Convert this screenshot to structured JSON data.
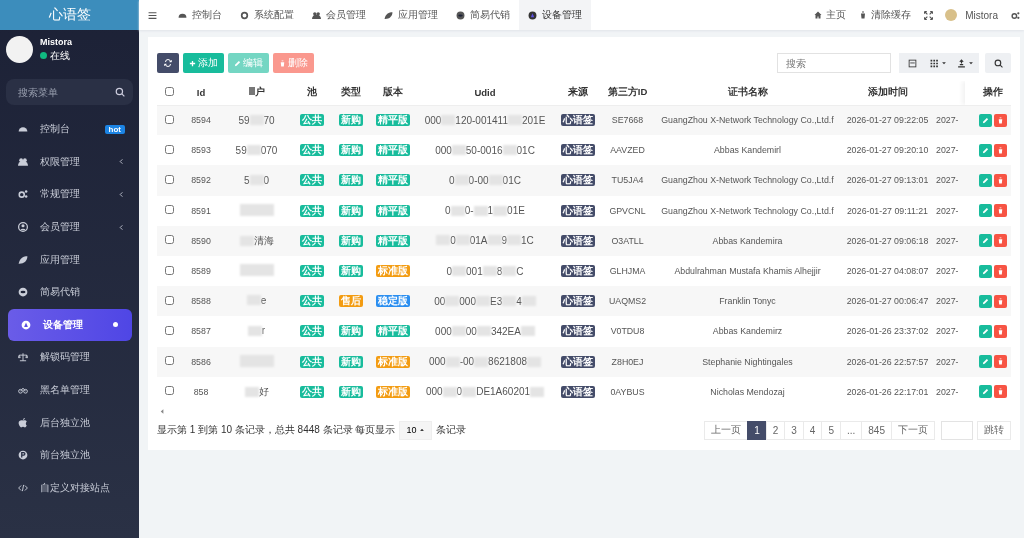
{
  "sidebar": {
    "logo": "心语签",
    "user": {
      "name": "Mistora",
      "status": "在线"
    },
    "search": {
      "placeholder": "搜索菜单"
    },
    "items": [
      {
        "label": "控制台",
        "badge": "hot",
        "expandable": false,
        "selected": false
      },
      {
        "label": "权限管理",
        "expandable": true,
        "selected": false
      },
      {
        "label": "常规管理",
        "expandable": true,
        "selected": false
      },
      {
        "label": "会员管理",
        "expandable": true,
        "selected": false
      },
      {
        "label": "应用管理",
        "expandable": false,
        "selected": false
      },
      {
        "label": "简易代销",
        "expandable": false,
        "selected": false
      },
      {
        "label": "设备管理",
        "expandable": false,
        "selected": true
      },
      {
        "label": "解锁码管理",
        "expandable": false,
        "selected": false
      },
      {
        "label": "黑名单管理",
        "expandable": false,
        "selected": false
      },
      {
        "label": "后台独立池",
        "expandable": false,
        "selected": false
      },
      {
        "label": "前台独立池",
        "expandable": false,
        "selected": false
      },
      {
        "label": "自定义对接站点",
        "expandable": false,
        "selected": false
      }
    ]
  },
  "topbar": {
    "tabs": [
      {
        "label": "控制台",
        "selected": false
      },
      {
        "label": "系统配置",
        "selected": false
      },
      {
        "label": "会员管理",
        "selected": false
      },
      {
        "label": "应用管理",
        "selected": false
      },
      {
        "label": "简易代销",
        "selected": false
      },
      {
        "label": "设备管理",
        "selected": true
      }
    ],
    "right": {
      "home": "主页",
      "clear_cache": "清除缓存",
      "user": "Mistora"
    }
  },
  "toolbar": {
    "buttons": [
      {
        "label": "添加",
        "kind": "add"
      },
      {
        "label": "编辑",
        "kind": "edit"
      },
      {
        "label": "删除",
        "kind": "delete"
      }
    ],
    "search": {
      "placeholder": "搜索"
    }
  },
  "table": {
    "header_checked": false,
    "columns": [
      "Id",
      "户",
      "池",
      "类型",
      "版本",
      "Udid",
      "来源",
      "第三方ID",
      "证书名称",
      "添加时间",
      "",
      "操作"
    ],
    "rows": [
      {
        "checked": false,
        "id": "8594",
        "user": [
          "59",
          {
            "kind": "redacted"
          },
          "70"
        ],
        "pool": "公共",
        "type": {
          "label": "新购",
          "kind": "new"
        },
        "version": {
          "label": "精平版",
          "kind": "green"
        },
        "udid": [
          "000",
          {
            "kind": "redacted"
          },
          "120-001411",
          {
            "kind": "redacted"
          },
          "201E"
        ],
        "source": "心语签",
        "third_party_id": "SE7668",
        "cert_name": "GuangZhou X-Network Technology Co.,Ltd.f",
        "added_time": "2026-01-27 09:22:05",
        "column_11": "2027-"
      },
      {
        "checked": false,
        "id": "8593",
        "user": [
          "59",
          {
            "kind": "redacted"
          },
          "070"
        ],
        "pool": "公共",
        "type": {
          "label": "新购",
          "kind": "new"
        },
        "version": {
          "label": "精平版",
          "kind": "green"
        },
        "udid": [
          "000",
          {
            "kind": "redacted"
          },
          "50-0016",
          {
            "kind": "redacted"
          },
          "01C"
        ],
        "source": "心语签",
        "third_party_id": "AAVZED",
        "cert_name": "Abbas Kandemirl",
        "added_time": "2026-01-27 09:20:10",
        "column_11": "2027-"
      },
      {
        "checked": false,
        "id": "8592",
        "user": [
          "5",
          {
            "kind": "redacted"
          },
          "0"
        ],
        "pool": "公共",
        "type": {
          "label": "新购",
          "kind": "new"
        },
        "version": {
          "label": "精平版",
          "kind": "green"
        },
        "udid": [
          "0",
          {
            "kind": "redacted"
          },
          "0-00",
          {
            "kind": "redacted"
          },
          "01C"
        ],
        "source": "心语签",
        "third_party_id": "TU5JA4",
        "cert_name": "GuangZhou X-Network Technology Co.,Ltd.f",
        "added_time": "2026-01-27 09:13:01",
        "column_11": "2027-"
      },
      {
        "checked": false,
        "id": "8591",
        "user": [
          {
            "kind": "redacted"
          }
        ],
        "pool": "公共",
        "type": {
          "label": "新购",
          "kind": "new"
        },
        "version": {
          "label": "精平版",
          "kind": "green"
        },
        "udid": [
          "0",
          {
            "kind": "redacted"
          },
          "0-",
          {
            "kind": "redacted"
          },
          "1",
          {
            "kind": "redacted"
          },
          "01E"
        ],
        "source": "心语签",
        "third_party_id": "GPVCNL",
        "cert_name": "GuangZhou X-Network Technology Co.,Ltd.f",
        "added_time": "2026-01-27 09:11:21",
        "column_11": "2027-"
      },
      {
        "checked": false,
        "id": "8590",
        "user": [
          {
            "kind": "redacted"
          },
          "清海"
        ],
        "pool": "公共",
        "type": {
          "label": "新购",
          "kind": "new"
        },
        "version": {
          "label": "精平版",
          "kind": "green"
        },
        "udid": [
          {
            "kind": "redacted"
          },
          "0",
          {
            "kind": "redacted"
          },
          "01A",
          {
            "kind": "redacted"
          },
          "9",
          {
            "kind": "redacted"
          },
          "1C"
        ],
        "source": "心语签",
        "third_party_id": "O3ATLL",
        "cert_name": "Abbas Kandemira",
        "added_time": "2026-01-27 09:06:18",
        "column_11": "2027-"
      },
      {
        "checked": false,
        "id": "8589",
        "user": [
          {
            "kind": "redacted"
          }
        ],
        "pool": "公共",
        "type": {
          "label": "新购",
          "kind": "new"
        },
        "version": {
          "label": "标准版",
          "kind": "orange"
        },
        "udid": [
          "0",
          {
            "kind": "redacted"
          },
          "001",
          {
            "kind": "redacted"
          },
          "8",
          {
            "kind": "redacted"
          },
          "C"
        ],
        "source": "心语签",
        "third_party_id": "GLHJMA",
        "cert_name": "Abdulrahman Mustafa Khamis Alhejjir",
        "added_time": "2026-01-27 04:08:07",
        "column_11": "2027-"
      },
      {
        "checked": false,
        "id": "8588",
        "user": [
          {
            "kind": "redacted"
          },
          "e"
        ],
        "pool": "公共",
        "type": {
          "label": "售后",
          "kind": "after_sale"
        },
        "version": {
          "label": "稳定版",
          "kind": "blue"
        },
        "udid": [
          "00",
          {
            "kind": "redacted"
          },
          "000",
          {
            "kind": "redacted"
          },
          "E3",
          {
            "kind": "redacted"
          },
          "4",
          {
            "kind": "redacted"
          }
        ],
        "source": "心语签",
        "third_party_id": "UAQMS2",
        "cert_name": "Franklin Tonyc",
        "added_time": "2026-01-27 00:06:47",
        "column_11": "2027-"
      },
      {
        "checked": false,
        "id": "8587",
        "user": [
          {
            "kind": "redacted"
          },
          "r"
        ],
        "pool": "公共",
        "type": {
          "label": "新购",
          "kind": "new"
        },
        "version": {
          "label": "精平版",
          "kind": "green"
        },
        "udid": [
          "000",
          {
            "kind": "redacted"
          },
          "00",
          {
            "kind": "redacted"
          },
          "342EA",
          {
            "kind": "redacted"
          }
        ],
        "source": "心语签",
        "third_party_id": "V0TDU8",
        "cert_name": "Abbas Kandemirz",
        "added_time": "2026-01-26 23:37:02",
        "column_11": "2027-"
      },
      {
        "checked": false,
        "id": "8586",
        "user": [
          {
            "kind": "redacted"
          }
        ],
        "pool": "公共",
        "type": {
          "label": "新购",
          "kind": "new"
        },
        "version": {
          "label": "标准版",
          "kind": "orange"
        },
        "udid": [
          "000",
          {
            "kind": "redacted"
          },
          "-00",
          {
            "kind": "redacted"
          },
          "8621808",
          {
            "kind": "redacted"
          }
        ],
        "source": "心语签",
        "third_party_id": "Z8H0EJ",
        "cert_name": "Stephanie Nightingales",
        "added_time": "2026-01-26 22:57:57",
        "column_11": "2027-"
      },
      {
        "checked": false,
        "id": "858",
        "user": [
          {
            "kind": "redacted"
          },
          "好"
        ],
        "pool": "公共",
        "type": {
          "label": "新购",
          "kind": "new"
        },
        "version": {
          "label": "标准版",
          "kind": "orange"
        },
        "udid": [
          "000",
          {
            "kind": "redacted"
          },
          "0",
          {
            "kind": "redacted"
          },
          "DE1A60201",
          {
            "kind": "redacted"
          }
        ],
        "source": "心语签",
        "third_party_id": "0AYBUS",
        "cert_name": "Nicholas Mendozaj",
        "added_time": "2026-01-26 22:17:01",
        "column_11": "2027-"
      }
    ]
  },
  "footer": {
    "summary": "显示第 1 到第 10 条记录，总共 8448 条记录 每页显示",
    "page_size": "10",
    "suffix": "条记录",
    "pagination": {
      "prev": "上一页",
      "pages": [
        {
          "label": "1",
          "selected": true
        },
        {
          "label": "2",
          "selected": false
        },
        {
          "label": "3",
          "selected": false
        },
        {
          "label": "4",
          "selected": false
        },
        {
          "label": "5",
          "selected": false
        },
        {
          "label": "...",
          "selected": false
        },
        {
          "label": "845",
          "selected": false
        }
      ],
      "next": "下一页",
      "jump": "跳转"
    }
  }
}
